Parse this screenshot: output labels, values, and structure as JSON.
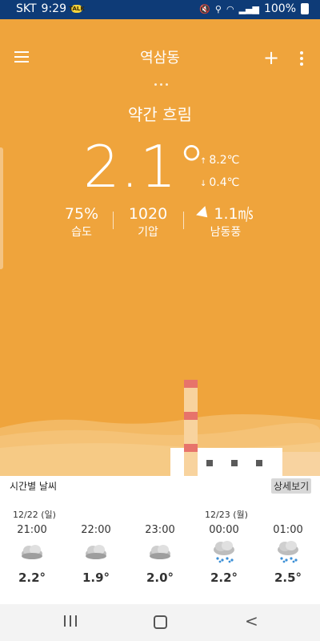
{
  "status_bar": {
    "carrier": "SKT",
    "time": "9:29",
    "chat_badge": "TALK",
    "battery": "100%"
  },
  "app_bar": {
    "location": "역삼동"
  },
  "current": {
    "condition": "약간 흐림",
    "temperature": "2.1°",
    "high": "8.2℃",
    "low": "0.4℃",
    "humidity_value": "75%",
    "humidity_label": "습도",
    "pressure_value": "1020",
    "pressure_label": "기압",
    "wind_value": "1.1㎧",
    "wind_label": "남동풍"
  },
  "hourly": {
    "title": "시간별 날씨",
    "detail_button": "상세보기",
    "dates": [
      "12/22 (일)",
      "12/23 (월)"
    ],
    "items": [
      {
        "time": "21:00",
        "icon": "cloudy-icon",
        "temp": "2.2°"
      },
      {
        "time": "22:00",
        "icon": "cloudy-icon",
        "temp": "1.9°"
      },
      {
        "time": "23:00",
        "icon": "cloudy-icon",
        "temp": "2.0°"
      },
      {
        "time": "00:00",
        "icon": "rain-icon",
        "temp": "2.2°"
      },
      {
        "time": "01:00",
        "icon": "rain-icon",
        "temp": "2.5°"
      }
    ]
  },
  "colors": {
    "status_bar": "#0e3b77",
    "background": "#efa43c",
    "text": "#ffffff"
  }
}
